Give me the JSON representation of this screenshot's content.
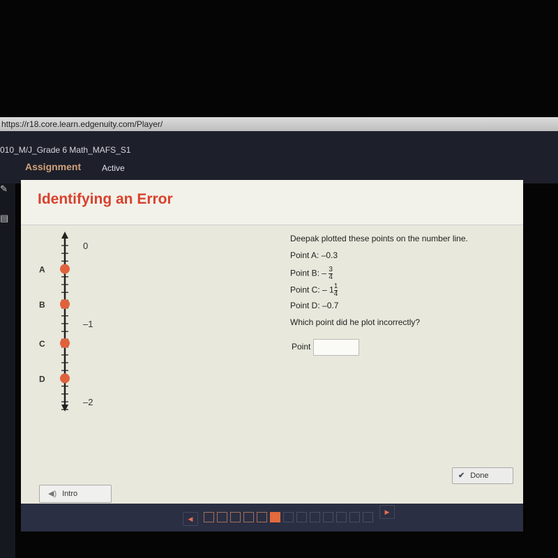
{
  "browser": {
    "url": "https://r18.core.learn.edgenuity.com/Player/"
  },
  "header": {
    "course": "010_M/J_Grade 6 Math_MAFS_S1",
    "section": "Assignment",
    "status": "Active"
  },
  "activity": {
    "title": "Identifying an Error",
    "number_line": {
      "labels": [
        {
          "value": 0,
          "text": "0"
        },
        {
          "value": -1,
          "text": "–1"
        },
        {
          "value": -2,
          "text": "–2"
        }
      ],
      "points": [
        {
          "name": "A",
          "value": -0.3
        },
        {
          "name": "B",
          "value": -0.75
        },
        {
          "name": "C",
          "value": -1.25
        },
        {
          "name": "D",
          "value": -1.7
        }
      ],
      "point_color": "#e0623c"
    },
    "prompt": "Deepak plotted these points on the number line.",
    "points_text": {
      "a": "Point A: –0.3",
      "b_prefix": "Point B: –",
      "b_num": "3",
      "b_den": "4",
      "c_prefix": "Point C: – 1",
      "c_num": "1",
      "c_den": "4",
      "d": "Point D: –0.7"
    },
    "question": "Which point did he plot incorrectly?",
    "answer_label": "Point",
    "answer_value": "",
    "done_label": "Done",
    "intro_label": "Intro"
  },
  "navigation": {
    "pages": [
      "done",
      "done",
      "done",
      "done",
      "done",
      "current",
      "new",
      "new",
      "new",
      "new",
      "new",
      "new",
      "new"
    ]
  },
  "colors": {
    "title": "#d9412d",
    "accent": "#e26a3c"
  }
}
